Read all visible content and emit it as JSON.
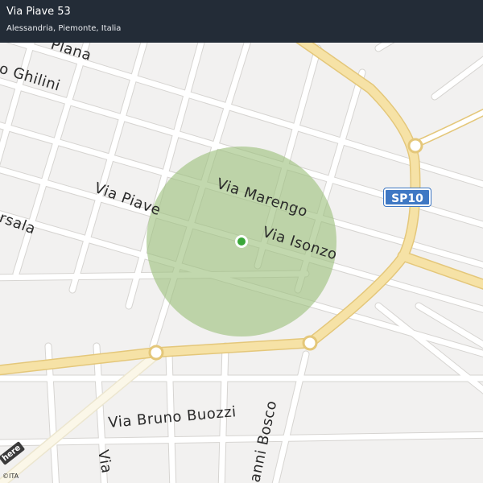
{
  "header": {
    "title": "Via Piave 53",
    "subtitle": "Alessandria, Piemonte, Italia"
  },
  "streets": {
    "plana": "Plana",
    "ghilini": "o  Ghilini",
    "piave": "Via  Piave",
    "marengo": "Via  Marengo",
    "isonzo": "Via  Isonzo",
    "marsala": "rsala",
    "buozzi": "Via  Bruno  Buozzi",
    "bosco": "anni  Bosco",
    "via_bottom": "Via"
  },
  "road_badge": "SP10",
  "logo": "here",
  "attribution": "©ITA",
  "colors": {
    "background": "#f2f1f0",
    "road": "#ffffff",
    "road_outline": "#d6d4d1",
    "highway": "#f6e2a6",
    "highway_outline": "#e4c77a",
    "radius_fill": "#9dc07d",
    "marker": "#3aa639",
    "header": "#232c37",
    "badge": "#3f78c4"
  }
}
